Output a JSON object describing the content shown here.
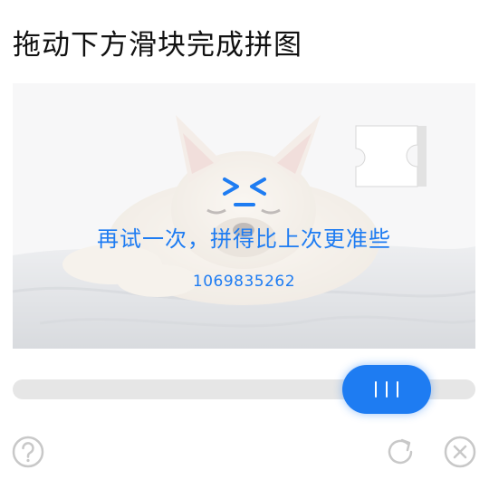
{
  "title": "拖动下方滑块完成拼图",
  "puzzle": {
    "face": ">_<",
    "message": "再试一次，拼得比上次更准些",
    "code": "1069835262",
    "piece_icon": "puzzle-piece-icon"
  },
  "slider": {
    "progress": 0.73,
    "thumb_icon": "grip-lines-icon"
  },
  "footer": {
    "help_icon": "help-icon",
    "refresh_icon": "refresh-icon",
    "close_icon": "close-icon"
  },
  "colors": {
    "accent": "#1e7cf2",
    "track": "#e6e6e6",
    "icon_gray": "#c8c8c8"
  }
}
